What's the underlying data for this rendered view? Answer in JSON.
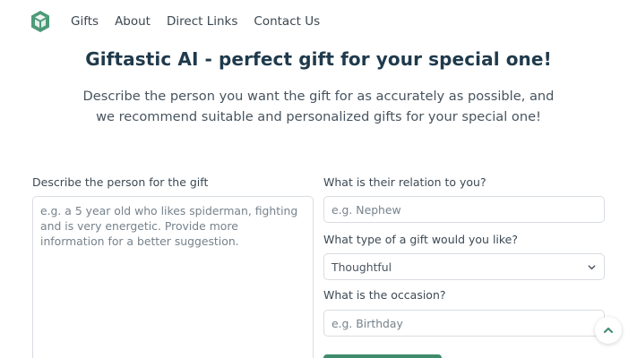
{
  "nav": {
    "logo_icon": "gift-logo-icon",
    "links": [
      "Gifts",
      "About",
      "Direct Links",
      "Contact Us"
    ]
  },
  "hero": {
    "title": "Giftastic AI - perfect gift for your special one!",
    "subtitle_line1": "Describe the person you want the gift for as accurately as possible, and",
    "subtitle_line2": "we recommend suitable and personalized gifts for your special one!"
  },
  "form": {
    "description": {
      "label": "Describe the person for the gift",
      "placeholder": "e.g. a 5 year old who likes spiderman, fighting and is very energetic. Provide more information for a better suggestion."
    },
    "relation": {
      "label": "What is their relation to you?",
      "placeholder": "e.g. Nephew"
    },
    "gift_type": {
      "label": "What type of a gift would you like?",
      "value": "Thoughtful"
    },
    "occasion": {
      "label": "What is the occasion?",
      "placeholder": "e.g. Birthday"
    }
  },
  "colors": {
    "brand_green": "#3d8b6b",
    "title_text": "#1f3a4c"
  },
  "icons": {
    "select": "chevron-down-icon",
    "scroll_top": "chevron-up-icon"
  }
}
